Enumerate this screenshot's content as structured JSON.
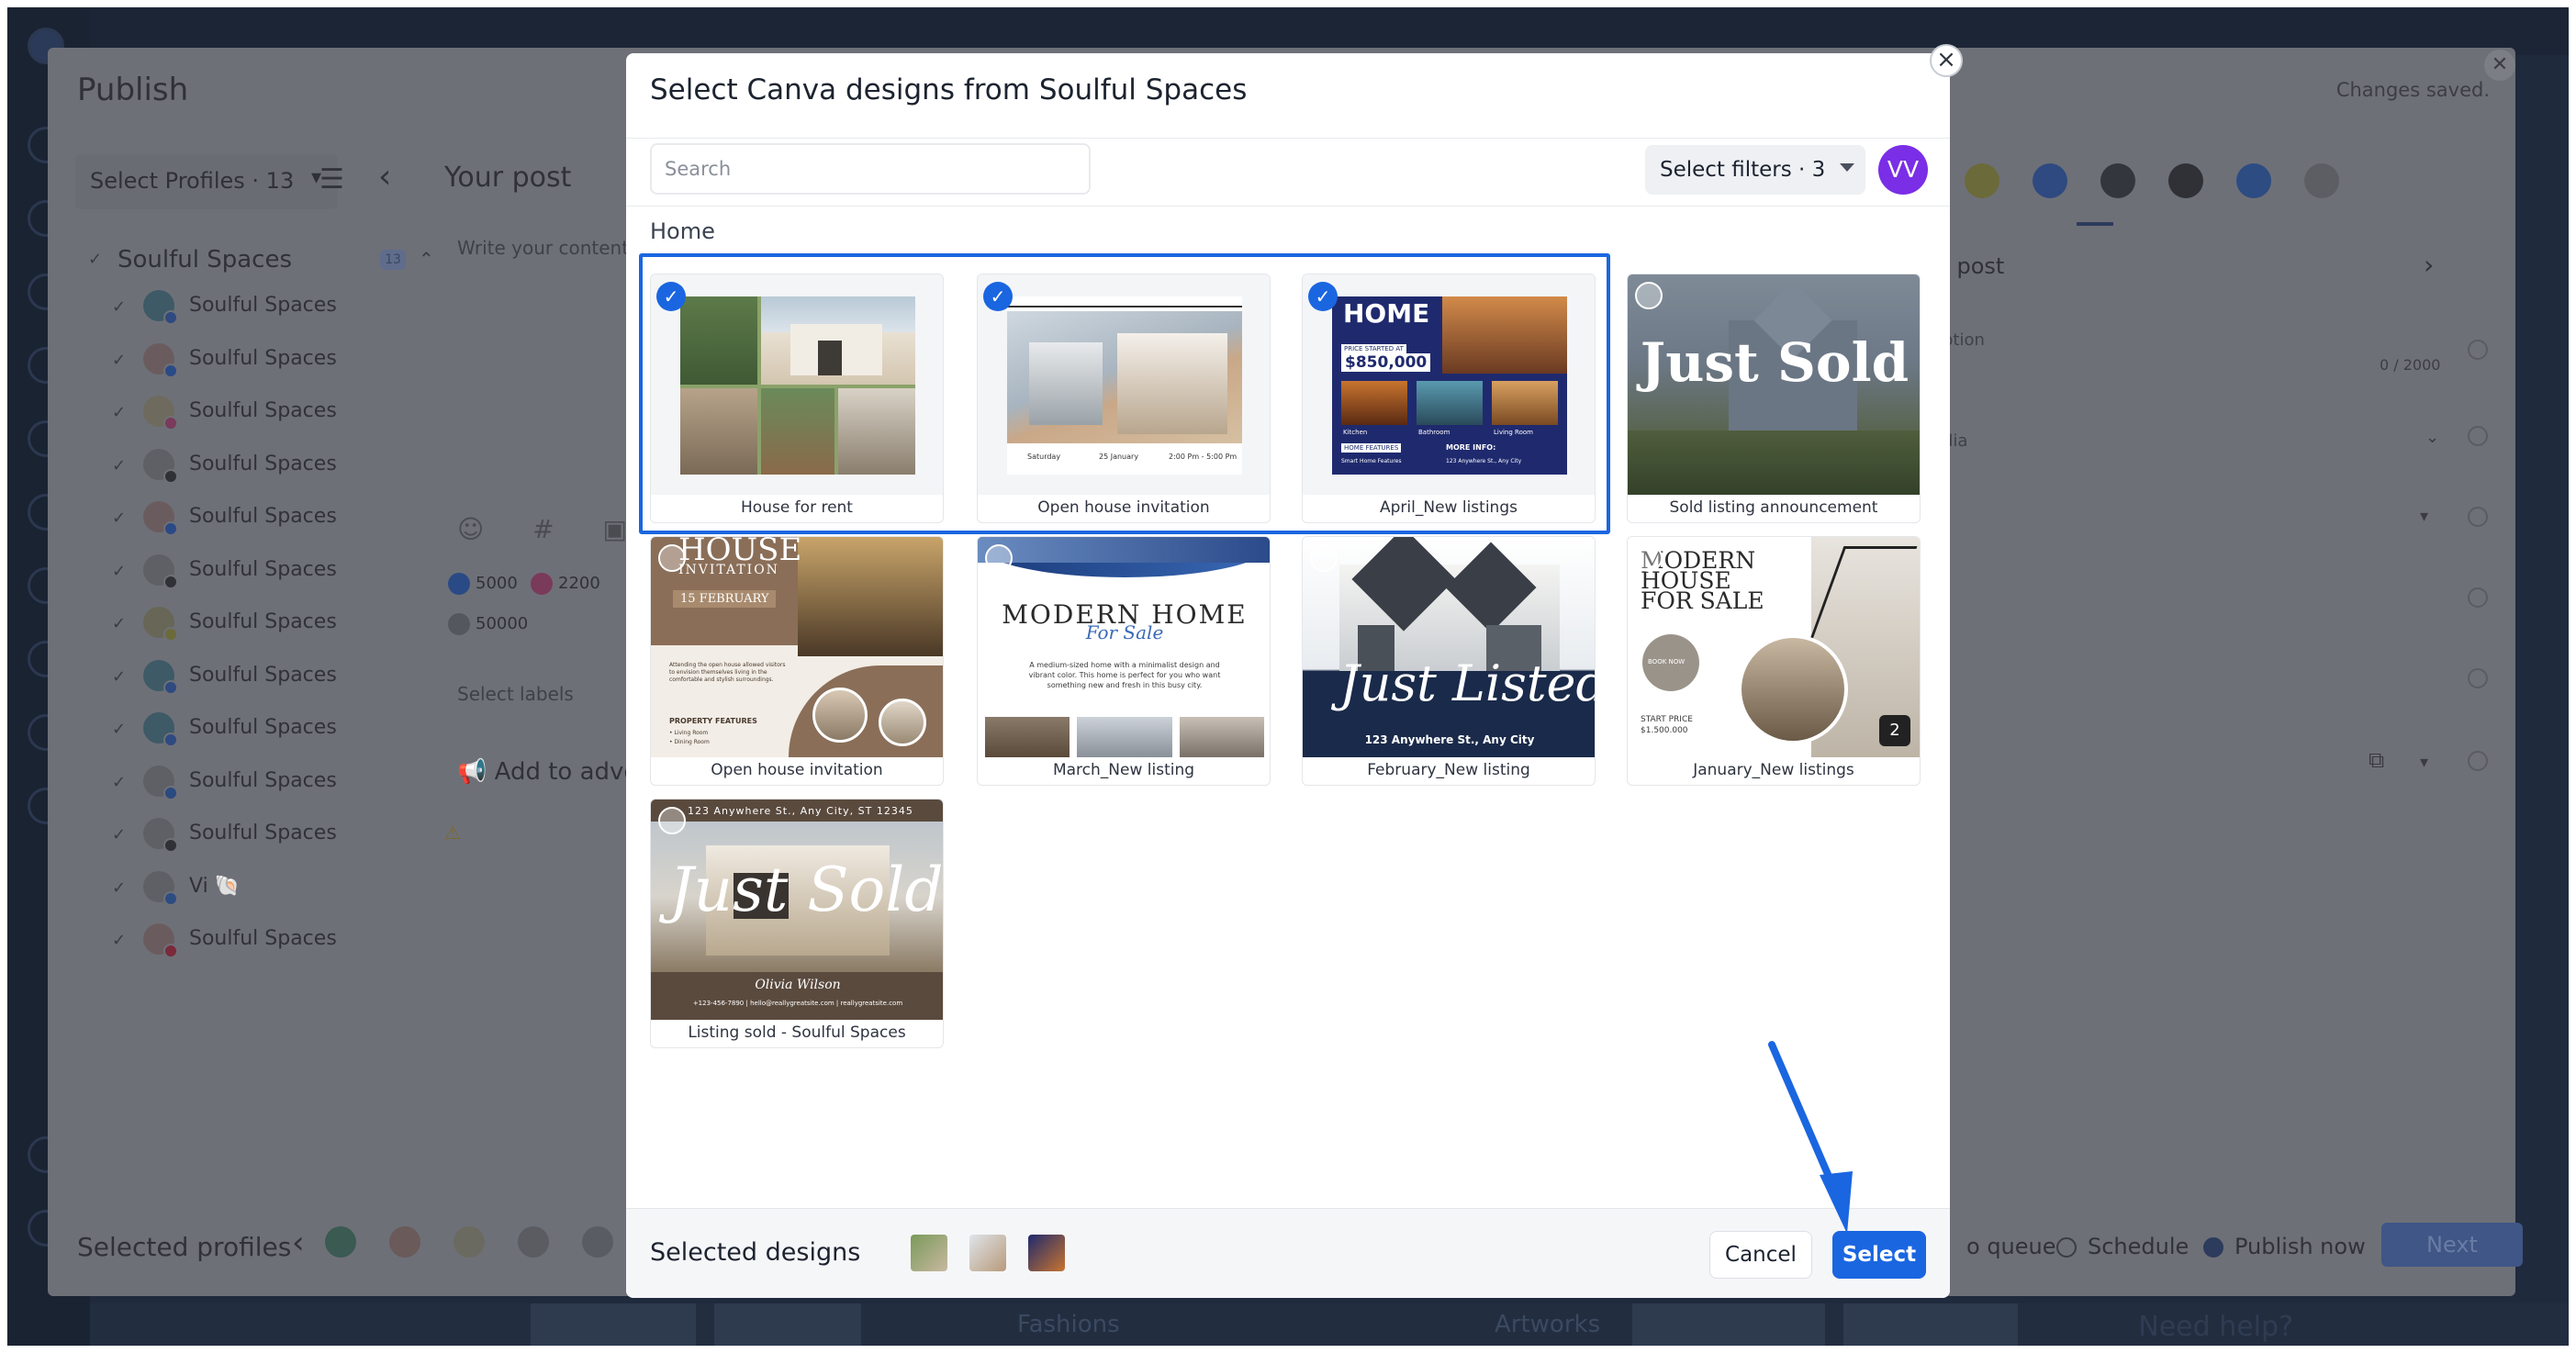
{
  "background": {
    "publish": {
      "title": "Publish",
      "changes_saved": "Changes saved.",
      "profiles_dropdown": "Select Profiles · 13",
      "your_post": "Your post",
      "write_content": "Write your content",
      "group": {
        "name": "Soulful Spaces",
        "badge": "13"
      },
      "profiles": [
        {
          "name": "Soulful Spaces",
          "network": "google-business"
        },
        {
          "name": "Soulful Spaces",
          "network": "facebook"
        },
        {
          "name": "Soulful Spaces",
          "network": "instagram"
        },
        {
          "name": "Soulful Spaces",
          "network": "x"
        },
        {
          "name": "Soulful Spaces",
          "network": "facebook"
        },
        {
          "name": "Soulful Spaces",
          "network": "threads"
        },
        {
          "name": "Soulful Spaces",
          "network": "snapchat"
        },
        {
          "name": "Soulful Spaces",
          "network": "google-business"
        },
        {
          "name": "Soulful Spaces",
          "network": "google-business"
        },
        {
          "name": "Soulful Spaces",
          "network": "linkedin"
        },
        {
          "name": "Soulful Spaces",
          "network": "tiktok",
          "warning": "⚠"
        },
        {
          "name": "Vi 🐚",
          "network": "bluesky"
        },
        {
          "name": "Soulful Spaces",
          "network": "pinterest"
        }
      ],
      "stats": [
        {
          "icon": "facebook-icon",
          "value": "5000"
        },
        {
          "icon": "instagram-icon",
          "value": "2200"
        },
        {
          "icon": "generic-icon",
          "value": "50000"
        }
      ],
      "select_labels": "Select labels",
      "add_to_advocacy": "Add to advo",
      "right_panel": {
        "your_post": "r post",
        "option": "ption",
        "counter": "0 / 2000",
        "media": "dia"
      },
      "bottom": {
        "selected_profiles": "Selected profiles",
        "add_to_queue": "o queue",
        "schedule": "Schedule",
        "publish_now": "Publish now",
        "next": "Next"
      }
    },
    "need_help": "Need help?",
    "strip": {
      "left_text": "Fashions",
      "right_text": "Artworks"
    }
  },
  "modal": {
    "title": "Select Canva designs from Soulful Spaces",
    "search_placeholder": "Search",
    "filters_label": "Select filters · 3",
    "user_initials": "VV",
    "breadcrumb": "Home",
    "designs": [
      {
        "caption": "House for rent",
        "selected": true
      },
      {
        "caption": "Open house invitation",
        "selected": true
      },
      {
        "caption": "April_New listings",
        "selected": true
      },
      {
        "caption": "Sold listing announcement",
        "selected": false
      },
      {
        "caption": "Open house invitation",
        "selected": false
      },
      {
        "caption": "March_New listing",
        "selected": false
      },
      {
        "caption": "February_New listing",
        "selected": false
      },
      {
        "caption": "January_New listings",
        "selected": false,
        "pages": "2"
      },
      {
        "caption": "Listing sold - Soulful Spaces",
        "selected": false
      }
    ],
    "thumb_text": {
      "home": "HOME",
      "price_started": "PRICE STARTED AT",
      "price": "$850,000",
      "home_features": "HOME FEATURES",
      "more_info": "MORE INFO:",
      "kitchen": "Kitchen",
      "bathroom": "Bathroom",
      "living_room": "Living Room",
      "smart_home": "Smart Home Features",
      "address_small": "123 Anywhere St., Any City",
      "just_sold": "Just Sold",
      "house": "HOUSE",
      "invitation": "INVITATION",
      "date": "15 FEBRUARY",
      "intro": "Attending the open house allowed visitors to envision themselves living in the comfortable and stylish surroundings.",
      "property_features": "PROPERTY FEATURES",
      "living_room_b": "• Living Room",
      "dining_room_b": "• Dining Room",
      "modern_home": "MODERN HOME",
      "for_sale_script": "For Sale",
      "modern_desc": "A medium-sized home with a minimalist design and vibrant color. This home is perfect for you who want something new and fresh in this busy city.",
      "just_listed": "Just Listed",
      "address": "123 Anywhere St., Any City",
      "modern_house": "MODERN",
      "house_line": "HOUSE",
      "for_sale": "FOR SALE",
      "book_now": "BOOK NOW",
      "start_price": "START PRICE",
      "start_price_value": "$1.500.000",
      "sold_top": "123 Anywhere St., Any City, ST 12345",
      "olivia": "Olivia Wilson",
      "contacts": "+123-456-7890 | hello@reallygreatsite.com | reallygreatsite.com",
      "saturday": "Saturday",
      "jan25": "25 January",
      "time": "2:00 Pm - 5:00 Pm"
    },
    "selected_designs_label": "Selected designs",
    "cancel_label": "Cancel",
    "select_label": "Select"
  },
  "colors": {
    "accent": "#1a66e0",
    "avatar": "#7a2ee6"
  }
}
